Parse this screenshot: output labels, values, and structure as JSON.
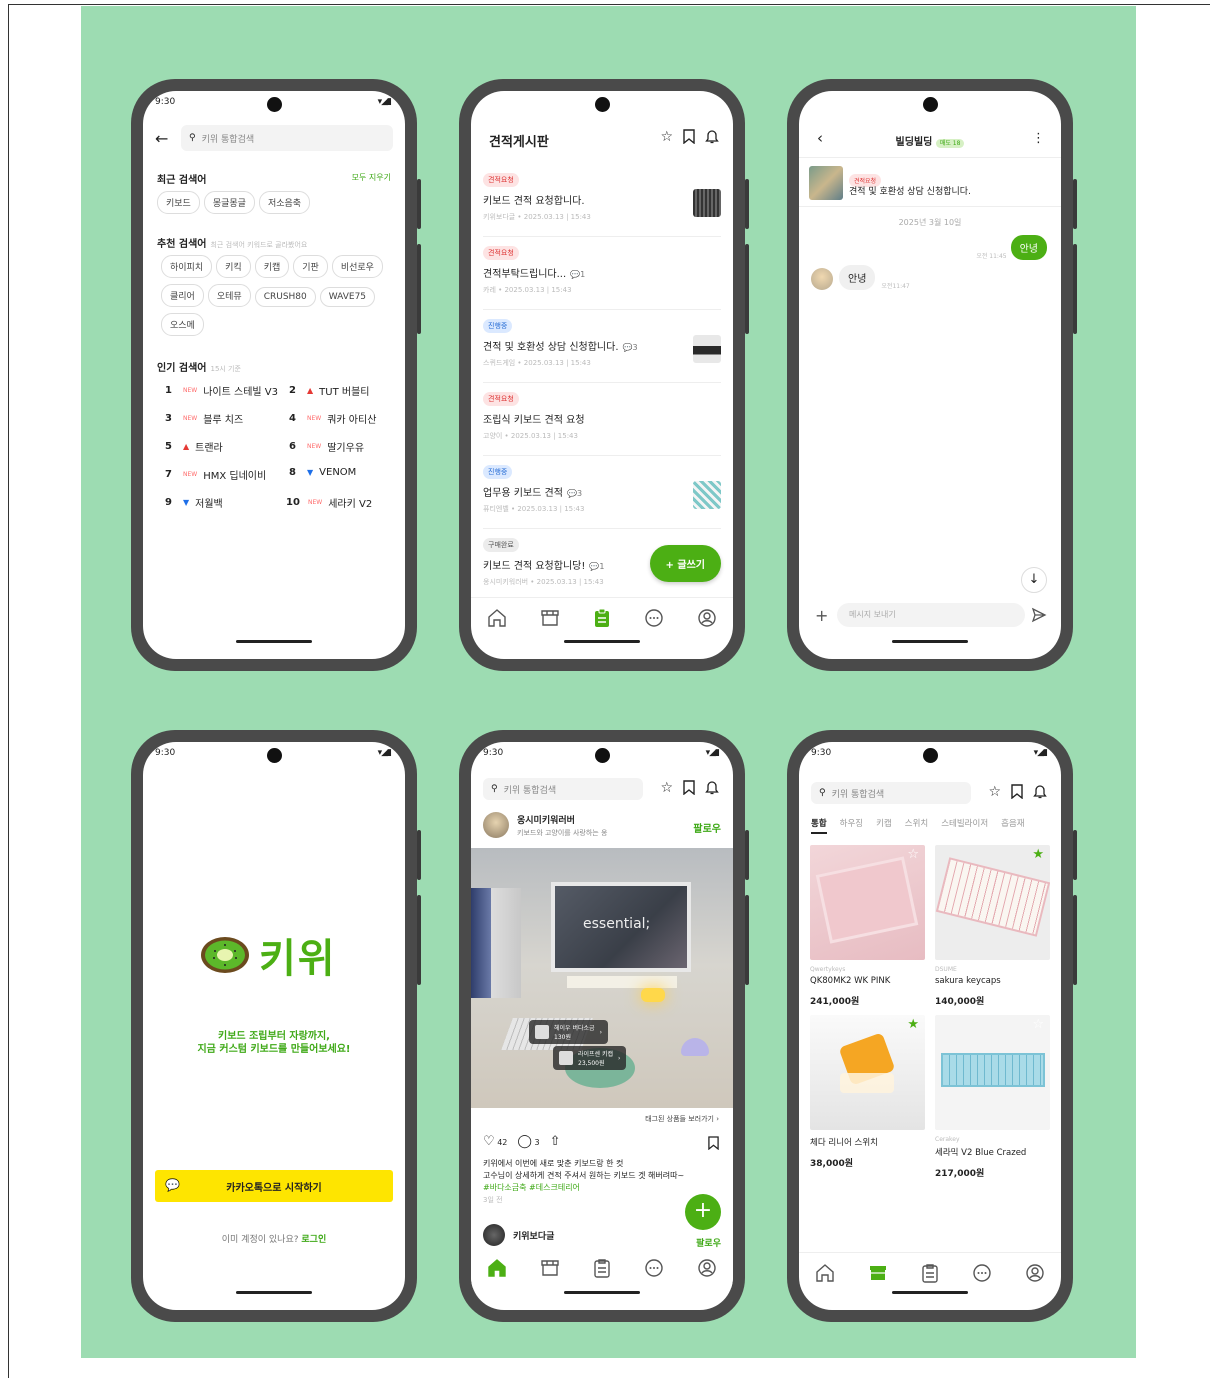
{
  "status_time": "9:30",
  "screen1": {
    "search_placeholder": "키위 통합검색",
    "recent_title": "최근 검색어",
    "clear_all": "모두 지우기",
    "recent_chips": [
      "키보드",
      "몽글몽글",
      "저소음축"
    ],
    "recommend_title": "추천 검색어",
    "recommend_sub": "최근 검색어 키워드로 골라봤어요",
    "recommend_chips": [
      "하이피치",
      "키킥",
      "키캡",
      "기판",
      "비선로우",
      "클리어",
      "오테뮤",
      "CRUSH80",
      "WAVE75",
      "오스메"
    ],
    "popular_title": "인기 검색어",
    "popular_sub": "15시 기준",
    "ranks": [
      {
        "n": "1",
        "mark": "NEW",
        "kind": "new",
        "name": "나이트 스테빌 V3"
      },
      {
        "n": "2",
        "mark": "▲",
        "kind": "up",
        "name": "TUT 버블티"
      },
      {
        "n": "3",
        "mark": "NEW",
        "kind": "new",
        "name": "블루 치즈"
      },
      {
        "n": "4",
        "mark": "NEW",
        "kind": "new",
        "name": "쿼카 아티산"
      },
      {
        "n": "5",
        "mark": "▲",
        "kind": "up",
        "name": "트랜라"
      },
      {
        "n": "6",
        "mark": "NEW",
        "kind": "new",
        "name": "딸기우유"
      },
      {
        "n": "7",
        "mark": "NEW",
        "kind": "new",
        "name": "HMX 딥네이비"
      },
      {
        "n": "8",
        "mark": "▼",
        "kind": "down",
        "name": "VENOM"
      },
      {
        "n": "9",
        "mark": "▼",
        "kind": "down",
        "name": "저월백"
      },
      {
        "n": "10",
        "mark": "NEW",
        "kind": "new",
        "name": "세라키 V2"
      }
    ]
  },
  "screen2": {
    "title": "견적게시판",
    "posts": [
      {
        "tag": "견적요청",
        "tagc": "red",
        "title": "키보드 견적 요청합니다.",
        "count": "",
        "meta": "키위보다글 • 2025.03.13 | 15:43"
      },
      {
        "tag": "견적요청",
        "tagc": "red",
        "title": "견적부탁드립니다...",
        "count": "1",
        "meta": "카레 • 2025.03.13 | 15:43"
      },
      {
        "tag": "진행중",
        "tagc": "blue",
        "title": "견적 및 호환성 상담 신청합니다.",
        "count": "3",
        "meta": "스퀴드게임 • 2025.03.13 | 15:43"
      },
      {
        "tag": "견적요청",
        "tagc": "red",
        "title": "조립식 키보드 견적 요청",
        "count": "",
        "meta": "고양이 • 2025.03.13 | 15:43"
      },
      {
        "tag": "진행중",
        "tagc": "blue",
        "title": "업무용 키보드 견적",
        "count": "3",
        "meta": "퓨티엔벨 • 2025.03.13 | 15:43"
      },
      {
        "tag": "구매완료",
        "tagc": "gray",
        "title": "키보드 견적 요청합니당!",
        "count": "1",
        "meta": "옹시미키워러버 • 2025.03.13 | 15:43"
      }
    ],
    "write_button": "+ 글쓰기"
  },
  "screen3": {
    "title": "빌딩빌딩",
    "badge": "매도 18",
    "pin_tag": "견적요청",
    "pin_title": "견적 및 호환성 상담 신청합니다.",
    "date": "2025년 3월 10일",
    "my_msg": "안녕",
    "my_time": "오전 11:45",
    "their_msg": "안녕",
    "their_time": "오전11:47",
    "input_placeholder": "메시지 보내기"
  },
  "screen4": {
    "logo_text": "키위",
    "tagline1": "키보드 조립부터 자랑까지,",
    "tagline2": "지금 커스텀 키보드를 만들어보세요!",
    "kakao_button": "카카오톡으로 시작하기",
    "has_account": "이미 계정이 있나요?",
    "login": "로그인"
  },
  "screen5": {
    "search_placeholder": "키위 통합검색",
    "user_name": "옹시미키워러버",
    "user_bio": "키보드와 고양이를 사랑하는 옹",
    "follow": "팔로우",
    "photo_text": "essential;",
    "tag1_name": "헤이우 버다소금",
    "tag1_price": "130원",
    "tag2_name": "라이프센 키캡",
    "tag2_price": "23,500원",
    "tagged_link": "태그된 상품들 보러가기",
    "likes": "42",
    "comments": "3",
    "caption1": "키위에서 이번에 새로 맞춘 키보드랑 한 컷",
    "caption2": "고수님이 상세하게 견적 주셔서 원하는 키보드 겟 해버려따~",
    "hashtags": "#바다소금축 #데스크테리어",
    "ago": "3일 전",
    "next_user": "키위보다글",
    "next_follow": "팔로우"
  },
  "screen6": {
    "search_placeholder": "키위 통합검색",
    "tabs": [
      "통합",
      "하우징",
      "키캡",
      "스위치",
      "스테빌라이저",
      "흡음재"
    ],
    "products": [
      {
        "brand": "Qwertykeys",
        "name": "QK80MK2 WK PINK",
        "price": "241,000원"
      },
      {
        "brand": "DSUME",
        "name": "sakura keycaps",
        "price": "140,000원"
      },
      {
        "brand": "",
        "name": "체다 리니어 스위치",
        "price": "38,000원"
      },
      {
        "brand": "Cerakey",
        "name": "세라믹 V2 Blue Crazed",
        "price": "217,000원"
      }
    ]
  },
  "colors": {
    "accent": "#4caf14",
    "kakao": "#fee500",
    "background": "#9ddcb2"
  }
}
